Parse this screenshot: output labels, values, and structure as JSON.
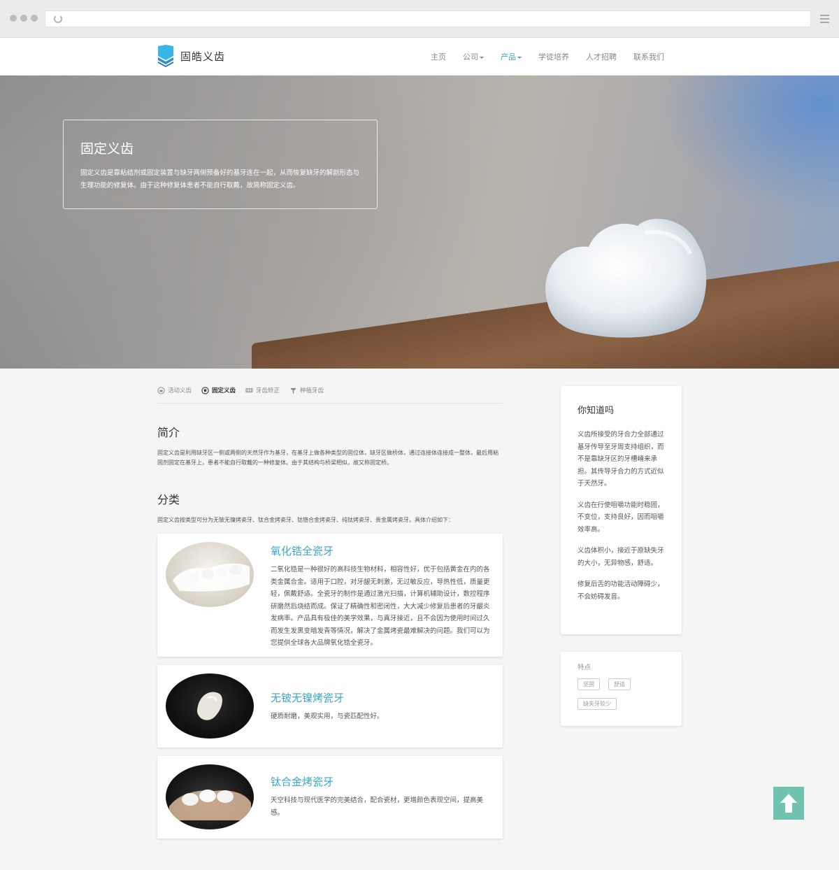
{
  "header": {
    "logo_text": "固皓义齿",
    "nav": [
      {
        "label": "主页",
        "dropdown": false,
        "active": false
      },
      {
        "label": "公司",
        "dropdown": true,
        "active": false
      },
      {
        "label": "产品",
        "dropdown": true,
        "active": true
      },
      {
        "label": "学徒培养",
        "dropdown": false,
        "active": false
      },
      {
        "label": "人才招聘",
        "dropdown": false,
        "active": false
      },
      {
        "label": "联系我们",
        "dropdown": false,
        "active": false
      }
    ]
  },
  "hero": {
    "title": "固定义齿",
    "description": "固定义齿是靠粘结剂或固定装置与缺牙两侧预备好的基牙连在一起，从而恢复缺牙的解剖形态与生理功能的修复体。由于这种修复体患者不能自行取戴，故简称固定义齿。"
  },
  "tabs": [
    {
      "label": "活动义齿",
      "icon": "removable-denture-icon",
      "active": false
    },
    {
      "label": "固定义齿",
      "icon": "fixed-denture-icon",
      "active": true
    },
    {
      "label": "牙齿矫正",
      "icon": "braces-icon",
      "active": false
    },
    {
      "label": "种植牙齿",
      "icon": "implant-icon",
      "active": false
    }
  ],
  "intro": {
    "title": "简介",
    "text": "固定义齿是利用缺牙区一侧或两侧的天然牙作为基牙，在基牙上做各种类型的固位体，缺牙区做桥体，通过连接体连接成一整体，最后用粘固剂固定在基牙上，患者不能自行取戴的一种修复体。由于其结构与桥梁相似，故又称固定桥。"
  },
  "category": {
    "title": "分类",
    "text": "固定义齿按类型可分为无铍无镍烤瓷牙、钛合金烤瓷牙、钴铬合金烤瓷牙、纯钛烤瓷牙、贵金属烤瓷牙。具体介绍如下："
  },
  "products": [
    {
      "title": "氧化锆全瓷牙",
      "text": "二氧化锆是一种很好的高科技生物材料，相容性好，优于包括黄金在内的各类金属合金。适用于口腔，对牙龈无刺激，无过敏反应，导热性低，质量更轻，佩戴舒适。全瓷牙的制作是通过激光扫描，计算机辅助设计，数控程序研磨然后烧结而成。保证了精确性和密闭性，大大减少修复后患者的牙龈炎发病率。产品具有极佳的美学效果，与真牙接近，且不会因为使用时间过久而发生发黑变暗发青等情况，解决了金属烤瓷最难解决的问题。我们可以为您提供全球各大品牌氧化锆全瓷牙。"
    },
    {
      "title": "无铍无镍烤瓷牙",
      "text": "硬质耐磨，美观实用，与瓷匹配性好。"
    },
    {
      "title": "钛合金烤瓷牙",
      "text": "天空科技与现代医学的完美结合，配合瓷材，更增颜色表现空间，提高美感。"
    }
  ],
  "sidebar": {
    "title": "你知道吗",
    "paragraphs": [
      "义齿所接受的牙合力全部通过基牙传导至牙周支持组织，而不是靠缺牙区的牙槽嵴来承担。其传导牙合力的方式近似于天然牙。",
      "义齿在行使咀嚼功能时稳固，不变位，支持良好，因而咀嚼效率高。",
      "义齿体积小，接近于原缺失牙的大小，无异物感，舒适。",
      "修复后舌的功能活动障碍少，不会妨碍发音。"
    ]
  },
  "features": {
    "title": "特点",
    "tags": [
      "坚固",
      "舒适",
      "缺失牙较少"
    ]
  },
  "colors": {
    "accent": "#3aa8c9",
    "totop": "#6fc2ad"
  }
}
